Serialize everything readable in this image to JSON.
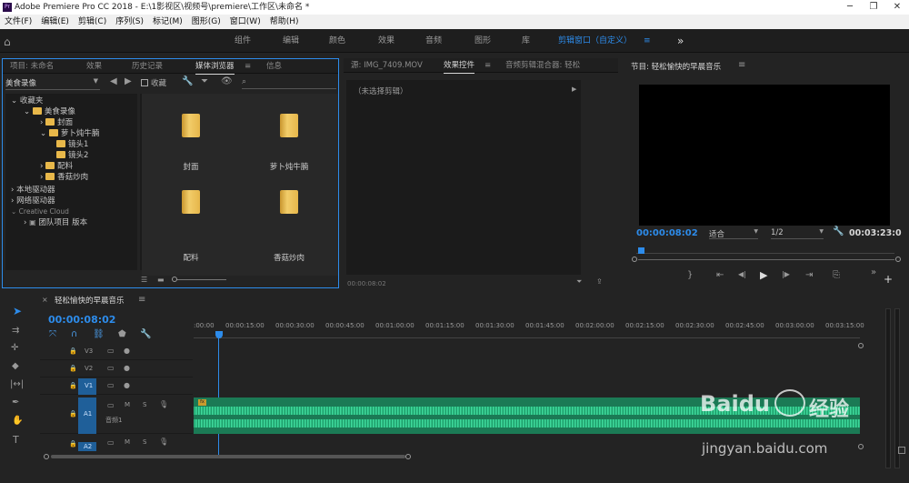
{
  "app": {
    "title": "Adobe Premiere Pro CC 2018 - E:\\1影视区\\视频号\\premiere\\工作区\\未命名 *",
    "icon_label": "Pr"
  },
  "menu": [
    "文件(F)",
    "编辑(E)",
    "剪辑(C)",
    "序列(S)",
    "标记(M)",
    "图形(G)",
    "窗口(W)",
    "帮助(H)"
  ],
  "workspaces": [
    "组件",
    "编辑",
    "颜色",
    "效果",
    "音频",
    "图形",
    "库"
  ],
  "workspace_active": "剪辑窗口（自定义）",
  "workspace_more": "»",
  "project_panel": {
    "tabs": [
      "项目: 未命名",
      "效果",
      "历史记录",
      "媒体浏览器",
      "信息"
    ],
    "location": "美食录像",
    "favorites_label": "收藏",
    "tree": {
      "favorites": "收藏夹",
      "root": "美食录像",
      "cover": "封面",
      "beef": "萝卜炖牛腩",
      "shot1": "镜头1",
      "shot2": "镜头2",
      "ingredients": "配料",
      "mushroom": "香菇炒肉",
      "local": "本地驱动器",
      "network": "网络驱动器",
      "cc": "Creative Cloud",
      "team": "团队项目 版本"
    },
    "tiles": [
      "封面",
      "萝卜炖牛腩",
      "配料",
      "香菇炒肉"
    ]
  },
  "source_panel": {
    "tabs": [
      "源: IMG_7409.MOV",
      "效果控件",
      "音频剪辑混合器: 轻松"
    ],
    "no_clip": "（未选择剪辑）",
    "timecode": "00:00:08:02"
  },
  "program_panel": {
    "title": "节目: 轻松愉快的早晨音乐",
    "timecode": "00:00:08:02",
    "fit": "适合",
    "quality": "1/2",
    "duration": "00:03:23:0"
  },
  "timeline": {
    "sequence": "轻松愉快的早晨音乐",
    "timecode": "00:00:08:02",
    "ruler": [
      ":00:00",
      "00:00:15:00",
      "00:00:30:00",
      "00:00:45:00",
      "00:01:00:00",
      "00:01:15:00",
      "00:01:30:00",
      "00:01:45:00",
      "00:02:00:00",
      "00:02:15:00",
      "00:02:30:00",
      "00:02:45:00",
      "00:03:00:00",
      "00:03:15:00"
    ],
    "tracks": {
      "v3": "V3",
      "v2": "V2",
      "v1": "V1",
      "a1": "A1",
      "a1_name": "音频1",
      "a2": "A2",
      "m": "M",
      "s": "S"
    },
    "clip_fx": "fx"
  },
  "watermark": {
    "brand": "Baidu",
    "brand_cn": "经验",
    "url": "jingyan.baidu.com"
  },
  "colors": {
    "accent": "#2d8ceb",
    "audio": "#2fbf86",
    "arrow": "#e02a2a",
    "folder": "#e8b84a"
  }
}
